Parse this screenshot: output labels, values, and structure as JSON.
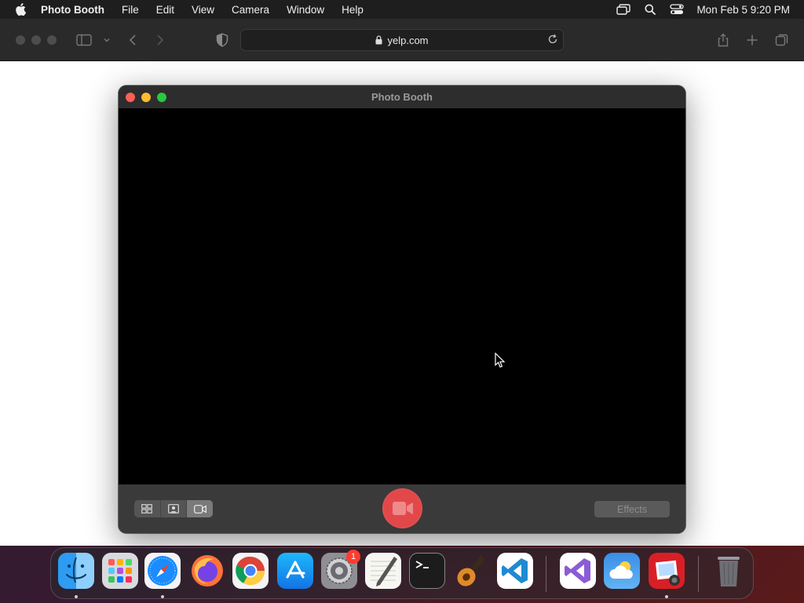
{
  "menubar": {
    "app_name": "Photo Booth",
    "menus": [
      "File",
      "Edit",
      "View",
      "Camera",
      "Window",
      "Help"
    ],
    "clock": "Mon Feb 5  9:20 PM"
  },
  "safari": {
    "url": "yelp.com"
  },
  "photo_booth": {
    "title": "Photo Booth",
    "effects_label": "Effects",
    "record_color": "#e2484a"
  },
  "dock": {
    "apps": [
      "Finder",
      "Launchpad",
      "Safari",
      "Firefox",
      "Chrome",
      "App Store",
      "System Settings",
      "TextEdit",
      "Terminal",
      "GarageBand",
      "Visual Studio Code",
      "Visual Studio",
      "Weather",
      "Photo Booth",
      "Trash"
    ],
    "system_settings_badge": "1"
  }
}
